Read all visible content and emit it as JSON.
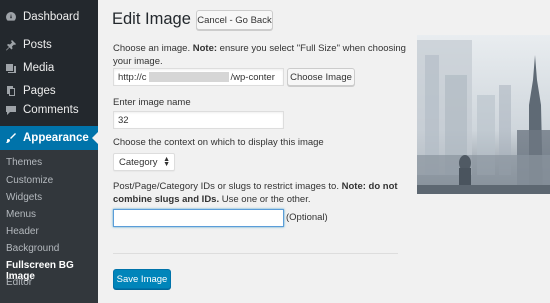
{
  "sidebar": {
    "items": [
      {
        "label": "Dashboard",
        "icon": "dashboard-icon"
      },
      {
        "label": "Posts",
        "icon": "pin-icon"
      },
      {
        "label": "Media",
        "icon": "media-icon"
      },
      {
        "label": "Pages",
        "icon": "pages-icon"
      },
      {
        "label": "Comments",
        "icon": "comments-icon"
      },
      {
        "label": "Appearance",
        "icon": "paintbrush-icon"
      }
    ],
    "submenu": [
      "Themes",
      "Customize",
      "Widgets",
      "Menus",
      "Header",
      "Background",
      "Fullscreen BG Image",
      "Editor"
    ]
  },
  "page": {
    "title": "Edit Image -",
    "cancel_label": "Cancel - Go Back"
  },
  "form": {
    "choose_label_pre": "Choose an image.",
    "choose_label_note": "Note:",
    "choose_label_post": "ensure you select \"Full Size\" when choosing your image.",
    "url_prefix": "http://c",
    "url_suffix": "/wp-conter",
    "choose_button": "Choose Image",
    "name_label": "Enter image name",
    "name_value": "32",
    "context_label": "Choose the context on which to display this image",
    "context_value": "Category",
    "ids_label_pre": "Post/Page/Category IDs or slugs to restrict images to.",
    "ids_label_note": "Note: do not combine slugs and IDs.",
    "ids_label_post": "Use one or the other.",
    "ids_value": "",
    "optional_label": "(Optional)",
    "save_button": "Save Image"
  },
  "colors": {
    "sidebar_bg": "#23282d",
    "active_bg": "#0073aa",
    "primary_button": "#0085ba"
  }
}
